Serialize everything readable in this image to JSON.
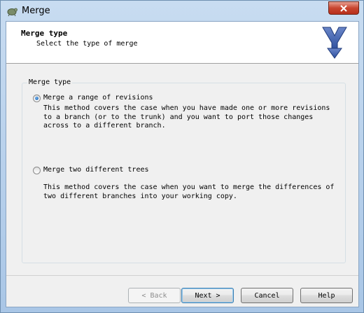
{
  "window": {
    "title": "Merge"
  },
  "header": {
    "title": "Merge type",
    "subtitle": "Select the type of merge"
  },
  "group": {
    "label": "Merge type",
    "options": [
      {
        "label": "Merge a range of revisions",
        "selected": true,
        "description": "This method covers the case when you have made one or more revisions\nto a branch (or to the trunk) and you want to port those changes\nacross to a different branch."
      },
      {
        "label": "Merge two different trees",
        "selected": false,
        "description": "This method covers the case when you want to merge the differences of\ntwo different branches into your working copy."
      }
    ]
  },
  "buttons": {
    "back": "< Back",
    "next": "Next >",
    "cancel": "Cancel",
    "help": "Help"
  }
}
